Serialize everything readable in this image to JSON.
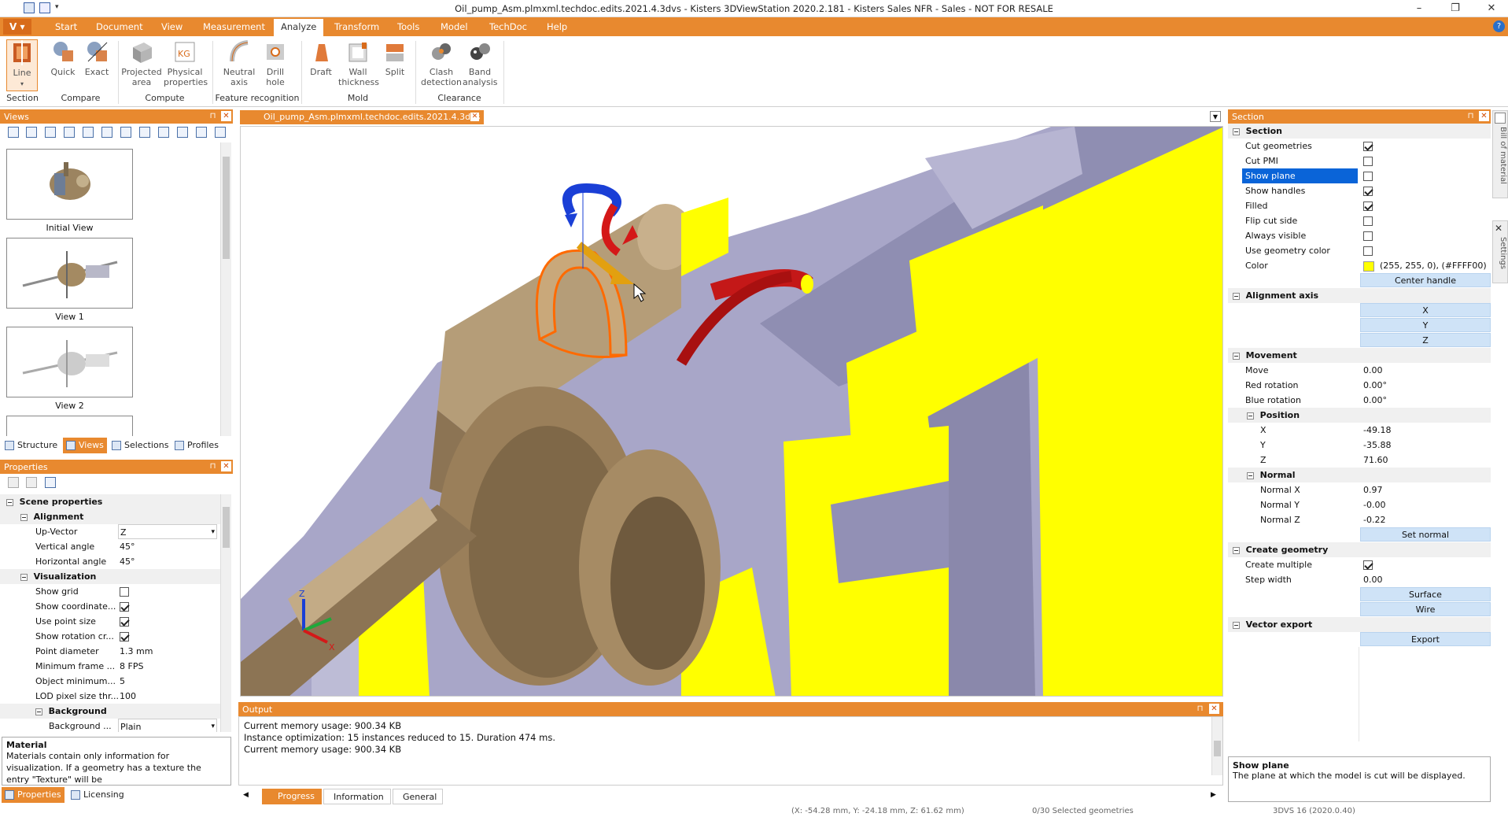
{
  "window": {
    "title": "Oil_pump_Asm.plmxml.techdoc.edits.2021.4.3dvs - Kisters 3DViewStation 2020.2.181 - Kisters Sales NFR - Sales - NOT FOR RESALE"
  },
  "menu": {
    "app_button": "V",
    "items": [
      "Start",
      "Document",
      "View",
      "Measurement",
      "Analyze",
      "Transform",
      "Tools",
      "Model",
      "TechDoc",
      "Help"
    ],
    "active": "Analyze"
  },
  "ribbon": {
    "buttons": {
      "line": "Line",
      "quick": "Quick",
      "exact": "Exact",
      "projected_area": "Projected area",
      "physical_properties": "Physical properties",
      "neutral_axis": "Neutral axis",
      "drill_hole": "Drill hole",
      "draft": "Draft",
      "wall_thickness": "Wall thickness",
      "split": "Split",
      "clash_detection": "Clash detection",
      "band_analysis": "Band analysis"
    },
    "groups": {
      "section": "Section",
      "compare": "Compare",
      "compute": "Compute",
      "feature_recognition": "Feature recognition",
      "mold": "Mold",
      "clearance": "Clearance"
    }
  },
  "views_panel": {
    "title": "Views",
    "thumbnails": [
      "Initial View",
      "View 1",
      "View 2"
    ],
    "tabs": [
      "Structure",
      "Views",
      "Selections",
      "Profiles"
    ],
    "active_tab": "Views"
  },
  "properties_panel": {
    "title": "Properties",
    "scene_properties": "Scene properties",
    "alignment": "Alignment",
    "up_vector_label": "Up-Vector",
    "up_vector_value": "Z",
    "vertical_angle_label": "Vertical angle",
    "vertical_angle_value": "45°",
    "horizontal_angle_label": "Horizontal angle",
    "horizontal_angle_value": "45°",
    "visualization": "Visualization",
    "show_grid": "Show grid",
    "show_coordinate": "Show coordinate...",
    "use_point_size": "Use point size",
    "show_rotation": "Show rotation cr...",
    "point_diameter_label": "Point diameter",
    "point_diameter_value": "1.3 mm",
    "min_frame_label": "Minimum frame ...",
    "min_frame_value": "8 FPS",
    "object_min_label": "Object minimum...",
    "object_min_value": "5",
    "lod_label": "LOD pixel size thr...",
    "lod_value": "100",
    "background": "Background",
    "background_label": "Background ...",
    "background_value": "Plain",
    "material_title": "Material",
    "material_desc": "Materials contain only information for visualization. If a geometry has a texture the entry \"Texture\" will be",
    "tabs": [
      "Properties",
      "Licensing"
    ],
    "active_tab": "Properties"
  },
  "document": {
    "tab_label": "Oil_pump_Asm.plmxml.techdoc.edits.2021.4.3dvs"
  },
  "output": {
    "title": "Output",
    "lines": [
      "Current memory usage: 900.34 KB",
      "Instance optimization: 15 instances reduced to 15. Duration 474 ms.",
      "Current memory usage: 900.34 KB"
    ],
    "tabs": [
      "Progress",
      "Information",
      "General"
    ],
    "active_tab": "Progress"
  },
  "section_panel": {
    "title": "Section",
    "section_header": "Section",
    "cut_geometries": "Cut geometries",
    "cut_pmi": "Cut PMI",
    "show_plane": "Show plane",
    "show_handles": "Show handles",
    "filled": "Filled",
    "flip_cut_side": "Flip cut side",
    "always_visible": "Always visible",
    "use_geometry_color": "Use geometry color",
    "color_label": "Color",
    "color_value": "(255, 255, 0), (#FFFF00)",
    "center_handle": "Center handle",
    "alignment_axis": "Alignment axis",
    "axis_x": "X",
    "axis_y": "Y",
    "axis_z": "Z",
    "movement": "Movement",
    "move_label": "Move",
    "move_value": "0.00",
    "red_rotation_label": "Red rotation",
    "red_rotation_value": "0.00°",
    "blue_rotation_label": "Blue rotation",
    "blue_rotation_value": "0.00°",
    "position": "Position",
    "pos_x_label": "X",
    "pos_x_value": "-49.18",
    "pos_y_label": "Y",
    "pos_y_value": "-35.88",
    "pos_z_label": "Z",
    "pos_z_value": "71.60",
    "normal": "Normal",
    "normal_x_label": "Normal X",
    "normal_x_value": "0.97",
    "normal_y_label": "Normal Y",
    "normal_y_value": "-0.00",
    "normal_z_label": "Normal Z",
    "normal_z_value": "-0.22",
    "set_normal": "Set normal",
    "create_geometry": "Create geometry",
    "create_multiple": "Create multiple",
    "step_width_label": "Step width",
    "step_width_value": "0.00",
    "surface": "Surface",
    "wire": "Wire",
    "vector_export": "Vector export",
    "export": "Export",
    "help_title": "Show plane",
    "help_text": "The plane at which the model is cut will be displayed.",
    "side_tabs": [
      "Bill of material",
      "Settings"
    ]
  },
  "statusbar": {
    "coords": "(X: -54.28 mm, Y: -24.18 mm, Z: 61.62 mm)",
    "selected": "0/30 Selected geometries",
    "version": "3DVS 16 (2020.0.40)"
  },
  "colors": {
    "accent": "#e8892f",
    "section_fill": "#FFFF00",
    "selection": "#0a64d8"
  }
}
